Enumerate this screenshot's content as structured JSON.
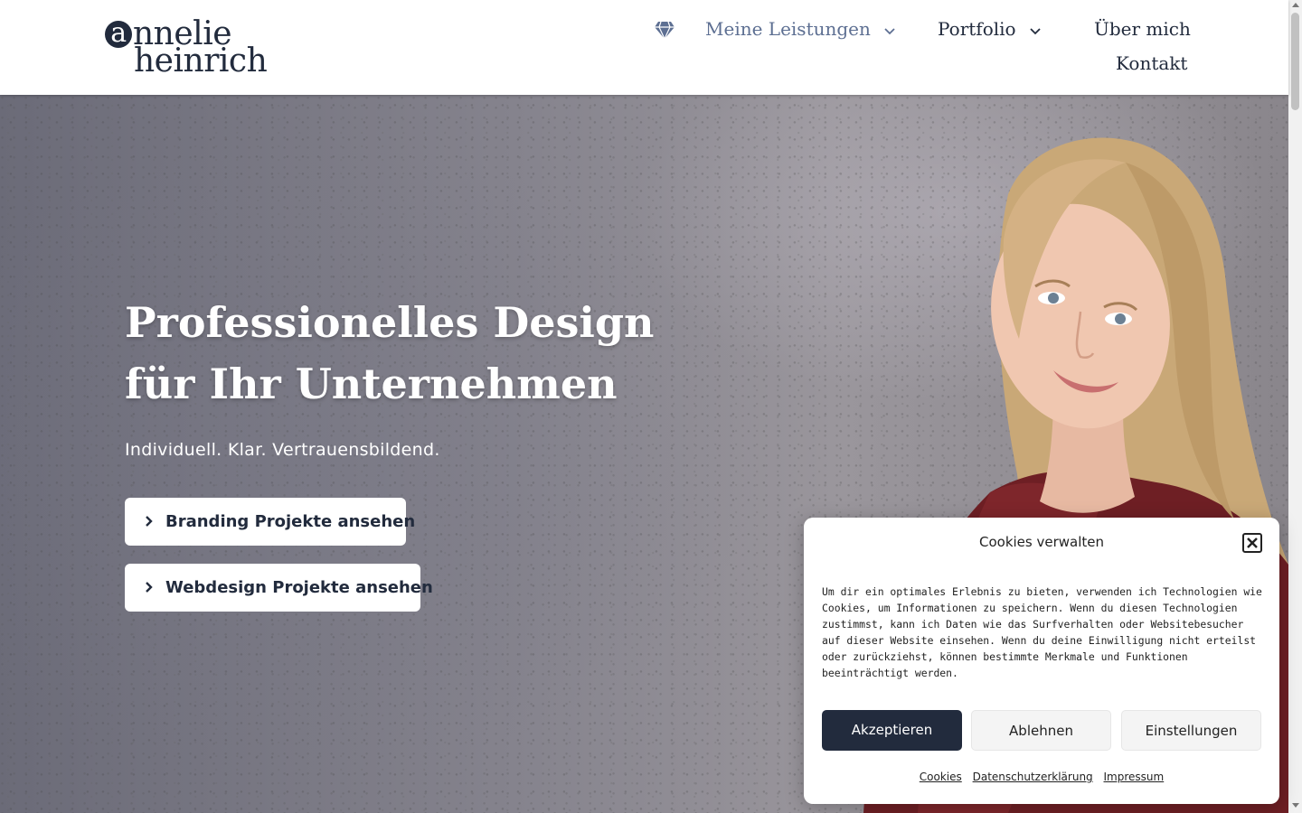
{
  "logo": {
    "line1_initial": "a",
    "line1_rest": "nnelie",
    "line2": "heinrich"
  },
  "nav": {
    "icon": "diamond-icon",
    "items": [
      {
        "label": "Meine Leistungen",
        "dropdown": true,
        "active": true
      },
      {
        "label": "Portfolio",
        "dropdown": true,
        "active": false
      },
      {
        "label": "Über mich",
        "dropdown": false,
        "active": false
      },
      {
        "label": "Kontakt",
        "dropdown": false,
        "active": false
      }
    ]
  },
  "hero": {
    "title_line1": "Professionelles Design",
    "title_line2": "für Ihr Unternehmen",
    "subtitle": "Individuell. Klar. Vertrauensbildend.",
    "buttons": [
      {
        "label": "Branding Projekte ansehen",
        "icon": "chevron-right-icon"
      },
      {
        "label": "Webdesign Projekte ansehen",
        "icon": "chevron-right-icon"
      }
    ]
  },
  "cookie": {
    "title": "Cookies verwalten",
    "text": "Um dir ein optimales Erlebnis zu bieten, verwenden ich Technologien wie Cookies, um Informationen zu speichern. Wenn du diesen Technologien zustimmst, kann ich Daten wie das Surfverhalten oder Websitebesucher auf dieser Website einsehen. Wenn du deine Einwilligung nicht erteilst oder zurückziehst, können bestimmte Merkmale und Funktionen beeinträchtigt werden.",
    "accept": "Akzeptieren",
    "deny": "Ablehnen",
    "settings": "Einstellungen",
    "links": [
      "Cookies",
      "Datenschutzerklärung",
      "Impressum"
    ]
  },
  "colors": {
    "brand": "#222b3d",
    "nav_active": "#5d6f92"
  }
}
